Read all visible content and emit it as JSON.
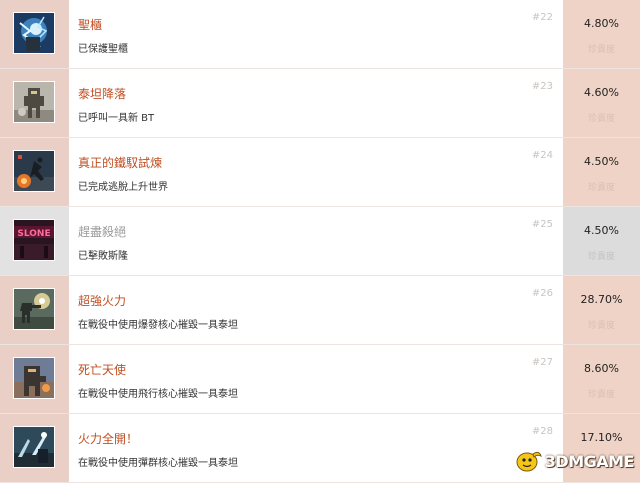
{
  "achievements": [
    {
      "title": "聖櫃",
      "desc": "已保護聖櫃",
      "num": "#22",
      "pct": "4.80%",
      "rarity": "珍貴度",
      "dim": false,
      "icon": "lightning-pilot-thumbnail"
    },
    {
      "title": "泰坦降落",
      "desc": "已呼叫一具新 BT",
      "num": "#23",
      "pct": "4.60%",
      "rarity": "珍貴度",
      "dim": false,
      "icon": "titan-landing-thumbnail"
    },
    {
      "title": "真正的鐵馭試煉",
      "desc": "已完成逃脫上升世界",
      "num": "#24",
      "pct": "4.50%",
      "rarity": "珍貴度",
      "dim": false,
      "icon": "pilot-jump-thumbnail"
    },
    {
      "title": "趕盡殺絕",
      "desc": "已擊敗斯隆",
      "num": "#25",
      "pct": "4.50%",
      "rarity": "珍貴度",
      "dim": true,
      "icon": "slone-sign-thumbnail"
    },
    {
      "title": "超強火力",
      "desc": "在戰役中使用爆發核心摧毀一具泰坦",
      "num": "#26",
      "pct": "28.70%",
      "rarity": "珍貴度",
      "dim": false,
      "icon": "titan-firing-thumbnail"
    },
    {
      "title": "死亡天使",
      "desc": "在戰役中使用飛行核心摧毀一具泰坦",
      "num": "#27",
      "pct": "8.60%",
      "rarity": "珍貴度",
      "dim": false,
      "icon": "flight-core-thumbnail"
    },
    {
      "title": "火力全開！",
      "desc": "在戰役中使用彈群核心摧毀一具泰坦",
      "num": "#28",
      "pct": "17.10%",
      "rarity": "珍貴度",
      "dim": false,
      "icon": "salvo-core-thumbnail"
    }
  ],
  "watermark": {
    "text": "3DMGAME",
    "icon": "banana-mascot-icon"
  }
}
